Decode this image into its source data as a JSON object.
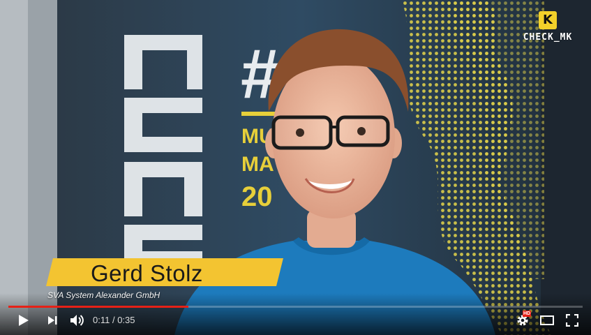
{
  "video": {
    "title": "",
    "channel_logo": {
      "mark": "K",
      "text": "CHECK_MK",
      "badge_color": "#f2d02a"
    },
    "lower_third": {
      "name": "Gerd Stolz",
      "company": "SVA System Alexander GmbH",
      "bar_color": "#f3c431"
    },
    "backdrop_text": {
      "vertical": "ENCE",
      "hash": "#",
      "lines": [
        "MU",
        "MA",
        "20"
      ]
    }
  },
  "player": {
    "accent_color": "#e62117",
    "progress_played_fraction": 0.314,
    "progress_loaded_fraction": 0.314,
    "current_time": "0:11",
    "separator": " / ",
    "duration": "0:35",
    "hd_label": "HD",
    "icons": [
      "play-icon",
      "next-icon",
      "volume-icon",
      "settings-icon",
      "theater-mode-icon",
      "fullscreen-icon"
    ]
  }
}
